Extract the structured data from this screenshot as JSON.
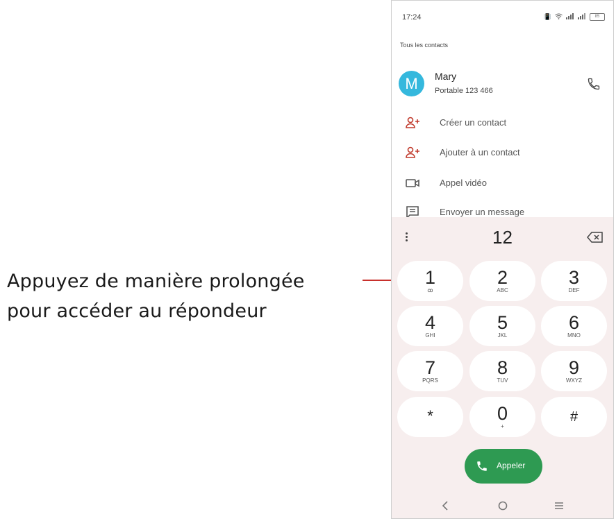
{
  "callout": {
    "line1": "Appuyez de manière prolongée",
    "line2": "pour accéder au répondeur"
  },
  "status_bar": {
    "time": "17:24",
    "battery": "85"
  },
  "contacts": {
    "section_label": "Tous les contacts",
    "contact": {
      "avatar_letter": "M",
      "name": "Mary",
      "number": "Portable 123 466"
    },
    "actions": [
      {
        "label": "Créer un contact",
        "icon": "add-person-icon"
      },
      {
        "label": "Ajouter à un contact",
        "icon": "add-person-icon"
      },
      {
        "label": "Appel vidéo",
        "icon": "video-camera-icon"
      },
      {
        "label": "Envoyer un message",
        "icon": "message-icon"
      }
    ]
  },
  "dialpad": {
    "number": "12",
    "keys": [
      {
        "digit": "1",
        "sub": "ꝏ"
      },
      {
        "digit": "2",
        "sub": "ABC"
      },
      {
        "digit": "3",
        "sub": "DEF"
      },
      {
        "digit": "4",
        "sub": "GHI"
      },
      {
        "digit": "5",
        "sub": "JKL"
      },
      {
        "digit": "6",
        "sub": "MNO"
      },
      {
        "digit": "7",
        "sub": "PQRS"
      },
      {
        "digit": "8",
        "sub": "TUV"
      },
      {
        "digit": "9",
        "sub": "WXYZ"
      },
      {
        "digit": "*",
        "sub": ""
      },
      {
        "digit": "0",
        "sub": "+"
      },
      {
        "digit": "#",
        "sub": ""
      }
    ],
    "call_label": "Appeler"
  },
  "colors": {
    "avatar": "#35b8dd",
    "call_button": "#2e9a52",
    "callout_line": "#c8302c",
    "dialpad_bg": "#f7eeee"
  }
}
